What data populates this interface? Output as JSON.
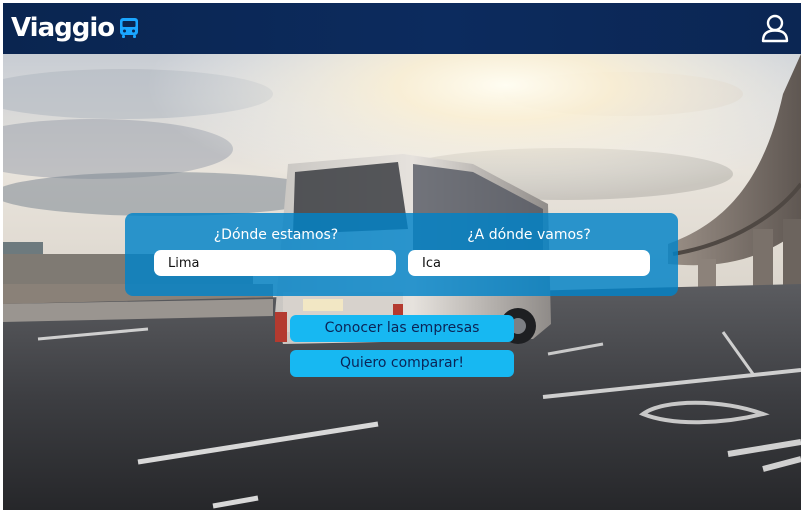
{
  "header": {
    "brand_name": "Viaggio",
    "brand_icon": "bus-icon",
    "user_icon": "user-icon",
    "colors": {
      "background": "#0a2550",
      "brand": "#ffffff",
      "accent": "#1aa6ff"
    }
  },
  "search": {
    "origin": {
      "label": "¿Dónde estamos?",
      "value": "Lima"
    },
    "destination": {
      "label": "¿A dónde vamos?",
      "value": "Ica"
    },
    "panel_color": "#0082c8"
  },
  "actions": {
    "companies_label": "Conocer las empresas",
    "compare_label": "Quiero comparar!",
    "button_color": "#17b8f2"
  },
  "hero": {
    "image": "bus-on-road-at-sunset"
  }
}
